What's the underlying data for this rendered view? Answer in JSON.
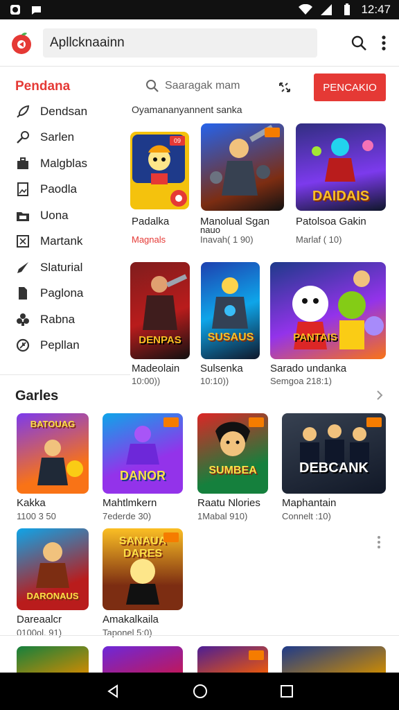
{
  "status_bar": {
    "time": "12:47"
  },
  "app_bar": {
    "search_value": "Apllcknaainn"
  },
  "sidebar": {
    "title": "Pendana",
    "items": [
      {
        "label": "Dendsan",
        "icon": "rocket-icon"
      },
      {
        "label": "Sarlen",
        "icon": "key-icon"
      },
      {
        "label": "Malgblas",
        "icon": "briefcase-icon"
      },
      {
        "label": "Paodla",
        "icon": "image-icon"
      },
      {
        "label": "Uona",
        "icon": "folder-icon"
      },
      {
        "label": "Martank",
        "icon": "tag-icon"
      },
      {
        "label": "Slaturial",
        "icon": "rocket-icon"
      },
      {
        "label": "Paglona",
        "icon": "file-icon"
      },
      {
        "label": "Rabna",
        "icon": "puzzle-icon"
      },
      {
        "label": "Pepllan",
        "icon": "clock-icon"
      }
    ]
  },
  "toolbar": {
    "search_placeholder": "Saaragak mam",
    "cta_label": "PENCAKIO"
  },
  "featured": {
    "subhead": "Oyamananyannent sanka",
    "cards": [
      {
        "title": "Padalka",
        "sub": "Magnals",
        "sub_red": true,
        "badge": "09"
      },
      {
        "title": "Manolual Sgan",
        "title2": "nauo",
        "sub": "Inavah( 1 90)",
        "badge": ""
      },
      {
        "title": "Patolsoa Gakin",
        "sub": "Marlaf ( 10)",
        "badge": ""
      },
      {
        "title": "Madeolain",
        "sub": "10:00))",
        "badge": ""
      },
      {
        "title": "Sulsenka",
        "sub": "10:10))",
        "badge": ""
      },
      {
        "title": "Sarado undanka",
        "sub": "Semgoa 218:1)",
        "badge": ""
      }
    ],
    "art_text": [
      "DAIDAIS",
      "SUSAUS",
      "DENPAS",
      "PANTAIS"
    ]
  },
  "games": {
    "title": "Garles",
    "cards": [
      {
        "title": "Kakka",
        "sub": "1100 3 50",
        "art": "BATOUAG"
      },
      {
        "title": "Mahtlmkern",
        "sub": "7ederde 30)",
        "art": "DANOR"
      },
      {
        "title": "Raatu Nlories",
        "sub": "1Mabal 910)",
        "art": "SUMBEA"
      },
      {
        "title": "Maphantain",
        "sub": "Connelt :10)",
        "art": "DEBCANK"
      },
      {
        "title": "Dareaalcr",
        "sub": "0100ol. 91)",
        "art": "DARONAUS"
      },
      {
        "title": "Amakalkaila",
        "sub": "Taponel 5:0)",
        "art": "SANAUA DARES"
      }
    ]
  },
  "colors": {
    "accent": "#e53935",
    "badge": "#f57c00"
  }
}
